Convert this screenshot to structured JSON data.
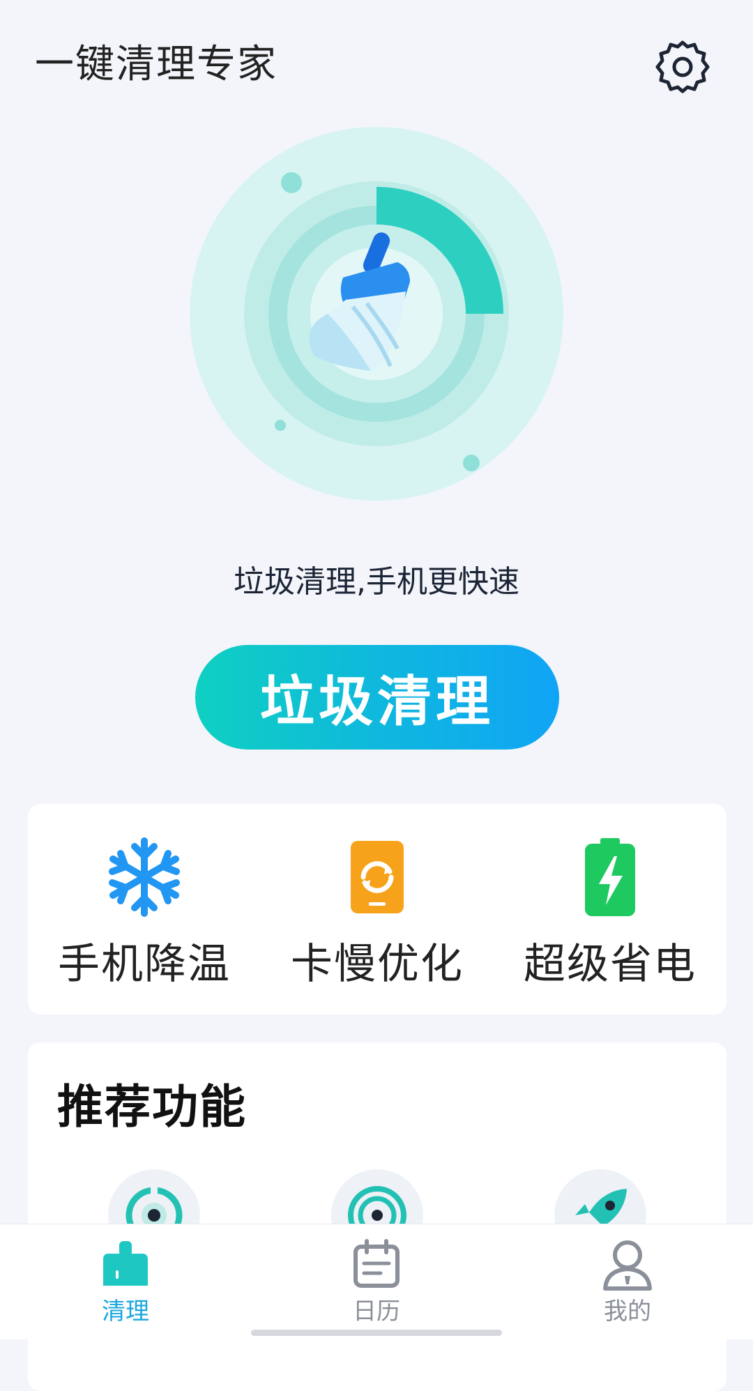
{
  "header": {
    "title": "一键清理专家",
    "settings_icon": "gear-icon"
  },
  "hero": {
    "icon": "broom-icon",
    "accent": "#2ccfc0"
  },
  "slogan": "垃圾清理,手机更快速",
  "main_button": {
    "label": "垃圾清理",
    "gradient": [
      "#0fd0c1",
      "#10a4f6"
    ]
  },
  "quick_actions": [
    {
      "label": "手机降温",
      "icon": "snowflake-icon",
      "color": "#2196f3"
    },
    {
      "label": "卡慢优化",
      "icon": "refresh-phone-icon",
      "color": "#f7a21b"
    },
    {
      "label": "超级省电",
      "icon": "battery-bolt-icon",
      "color": "#1ec95f"
    }
  ],
  "recommended": {
    "title": "推荐功能",
    "items": [
      {
        "icon": "target-icon"
      },
      {
        "icon": "radar-icon"
      },
      {
        "icon": "rocket-icon"
      }
    ]
  },
  "bottom_nav": [
    {
      "label": "清理",
      "icon": "broom-tab-icon",
      "active": true
    },
    {
      "label": "日历",
      "icon": "calendar-icon",
      "active": false
    },
    {
      "label": "我的",
      "icon": "person-icon",
      "active": false
    }
  ]
}
